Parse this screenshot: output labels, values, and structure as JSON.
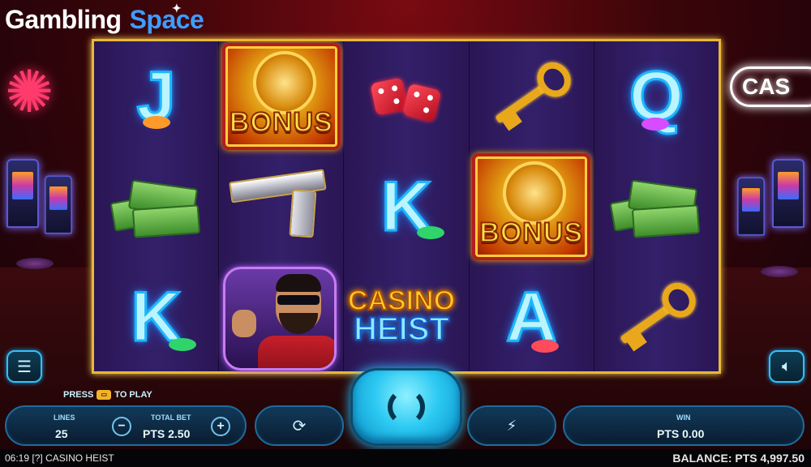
{
  "watermark": {
    "brand_a": "Gambling",
    "brand_b": "Space"
  },
  "background": {
    "sign_text": "CAS"
  },
  "reels": {
    "columns": [
      {
        "symbols": [
          "J",
          "cash-stack",
          "K"
        ]
      },
      {
        "symbols": [
          "bonus-vault",
          "pistol",
          "gangster-character"
        ]
      },
      {
        "symbols": [
          "red-dice",
          "K",
          "casino-heist-logo"
        ]
      },
      {
        "symbols": [
          "gold-key",
          "bonus-vault",
          "A"
        ]
      },
      {
        "symbols": [
          "Q",
          "cash-stack",
          "gold-key"
        ]
      }
    ],
    "letters": {
      "j": "J",
      "k": "K",
      "q": "Q",
      "a": "A"
    },
    "bonus_label": "BONUS",
    "logo_top": "CASINO",
    "logo_bottom": "HEIST"
  },
  "controls": {
    "hint_prefix": "PRESS",
    "hint_suffix": "TO PLAY",
    "lines_label": "LINES",
    "lines_value": "25",
    "total_bet_label": "TOTAL BET",
    "total_bet_value": "PTS 2.50",
    "minus": "−",
    "plus": "+",
    "win_label": "WIN",
    "win_value": "PTS 0.00"
  },
  "status_bar": {
    "time": "06:19",
    "help_glyph": "[?]",
    "game_name": "CASINO HEIST",
    "balance": "BALANCE: PTS 4,997.50"
  },
  "colors": {
    "frame_gold": "#e7b83a",
    "neon_blue": "#1fb6ff",
    "spin_cyan": "#2cc9f2"
  }
}
